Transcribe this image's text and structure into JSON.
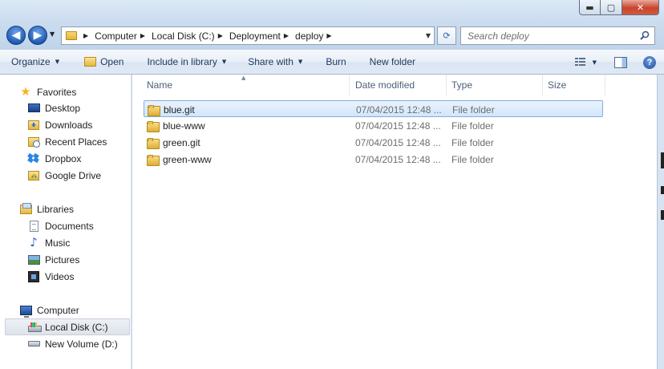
{
  "window": {
    "minimize_glyph": "▬",
    "maximize_glyph": "▢",
    "close_glyph": "✕"
  },
  "navigation": {
    "back_glyph": "◀",
    "forward_glyph": "▶",
    "recent_glyph": "▼",
    "refresh_glyph": "⟳"
  },
  "address_bar": {
    "breadcrumbs": [
      "Computer",
      "Local Disk (C:)",
      "Deployment",
      "deploy"
    ],
    "separator": "▶",
    "dropdown_glyph": "▼"
  },
  "search": {
    "placeholder": "Search deploy"
  },
  "command_bar": {
    "organize": "Organize",
    "open": "Open",
    "include_in_library": "Include in library",
    "share_with": "Share with",
    "burn": "Burn",
    "new_folder": "New folder",
    "dropdown_glyph": "▼",
    "help_glyph": "?"
  },
  "nav_pane": {
    "favorites": {
      "label": "Favorites",
      "items": [
        "Desktop",
        "Downloads",
        "Recent Places",
        "Dropbox",
        "Google Drive"
      ]
    },
    "libraries": {
      "label": "Libraries",
      "items": [
        "Documents",
        "Music",
        "Pictures",
        "Videos"
      ]
    },
    "computer": {
      "label": "Computer",
      "items": [
        "Local Disk (C:)",
        "New Volume (D:)"
      ],
      "selected": "Local Disk (C:)"
    }
  },
  "file_list": {
    "columns": [
      "Name",
      "Date modified",
      "Type",
      "Size"
    ],
    "sort_glyph": "▲",
    "rows": [
      {
        "name": "blue.git",
        "date": "07/04/2015 12:48 ...",
        "type": "File folder",
        "size": "",
        "selected": true
      },
      {
        "name": "blue-www",
        "date": "07/04/2015 12:48 ...",
        "type": "File folder",
        "size": "",
        "selected": false
      },
      {
        "name": "green.git",
        "date": "07/04/2015 12:48 ...",
        "type": "File folder",
        "size": "",
        "selected": false
      },
      {
        "name": "green-www",
        "date": "07/04/2015 12:48 ...",
        "type": "File folder",
        "size": "",
        "selected": false
      }
    ]
  },
  "colors": {
    "accent": "#1f5bb5",
    "selection_border": "#84acdd",
    "header_text": "#4c607a",
    "secondary_text": "#6d6d6d"
  }
}
